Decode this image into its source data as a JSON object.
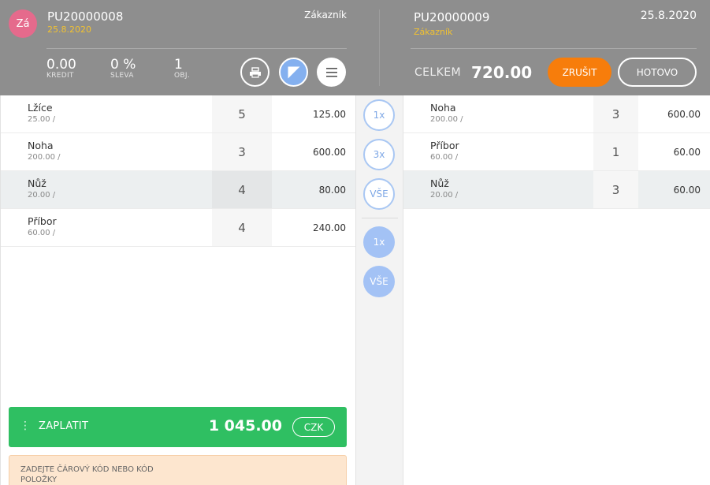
{
  "left_order": {
    "avatar_initials": "Zá",
    "doc_number": "PU20000008",
    "date": "25.8.2020",
    "customer_label": "Zákazník",
    "stats": [
      {
        "value": "0.00",
        "label": "KREDIT"
      },
      {
        "value": "0 %",
        "label": "SLEVA"
      },
      {
        "value": "1",
        "label": "OBJ."
      }
    ],
    "items": [
      {
        "name": "Lžíce",
        "price": "25.00 /",
        "qty": "5",
        "amount": "125.00",
        "selected": false
      },
      {
        "name": "Noha",
        "price": "200.00 /",
        "qty": "3",
        "amount": "600.00",
        "selected": false
      },
      {
        "name": "Nůž",
        "price": "20.00 /",
        "qty": "4",
        "amount": "80.00",
        "selected": true
      },
      {
        "name": "Příbor",
        "price": "60.00 /",
        "qty": "4",
        "amount": "240.00",
        "selected": false
      }
    ],
    "pay": {
      "dots": "⋮",
      "label": "ZAPLATIT",
      "amount": "1 045.00",
      "currency": "CZK"
    },
    "barcode_hint": "ZADEJTE ČÁROVÝ KÓD NEBO KÓD POLOŽKY"
  },
  "transfer_buttons": {
    "one": "1x",
    "three": "3x",
    "all": "VŠE",
    "back_one": "1x",
    "back_all": "VŠE"
  },
  "right_order": {
    "doc_number": "PU20000009",
    "customer": "Zákazník",
    "date": "25.8.2020",
    "total_label": "CELKEM",
    "total_value": "720.00",
    "cancel_label": "ZRUŠIT",
    "done_label": "HOTOVO",
    "items": [
      {
        "name": "Noha",
        "price": "200.00 /",
        "qty": "3",
        "amount": "600.00",
        "selected": false
      },
      {
        "name": "Příbor",
        "price": "60.00 /",
        "qty": "1",
        "amount": "60.00",
        "selected": false
      },
      {
        "name": "Nůž",
        "price": "20.00 /",
        "qty": "3",
        "amount": "60.00",
        "selected": true
      }
    ]
  },
  "icons": {
    "print": "printer-icon",
    "split": "split-icon",
    "menu": "hamburger-menu-icon"
  },
  "colors": {
    "header": "#8e8e8e",
    "pay": "#2fbf62",
    "cancel": "#f77d0b",
    "accent": "#84b0ef",
    "date": "#f2c230",
    "avatar": "#e56a8c"
  }
}
